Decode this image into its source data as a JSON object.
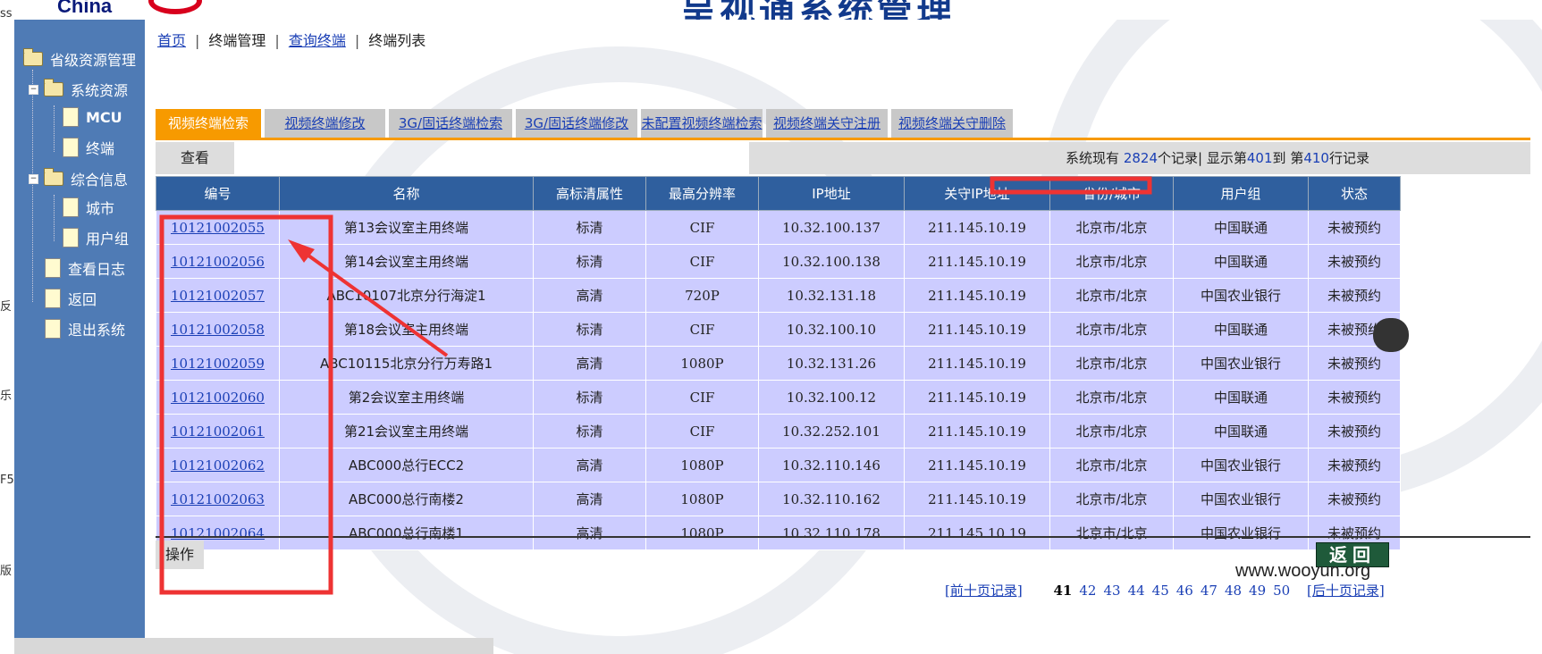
{
  "app": {
    "logo_text": "China",
    "banner_title": "呈视通系统管理"
  },
  "left_strip": [
    "ss",
    "反",
    "乐",
    "F5",
    "版"
  ],
  "sidebar": {
    "root": "省级资源管理",
    "groups": [
      {
        "label": "系统资源",
        "children": [
          "MCU",
          "终端"
        ]
      },
      {
        "label": "综合信息",
        "children": [
          "城市",
          "用户组"
        ]
      }
    ],
    "items": [
      "查看日志",
      "返回",
      "退出系统"
    ]
  },
  "breadcrumb": {
    "home": "首页",
    "terminal_mgmt": "终端管理",
    "query_terminal": "查询终端",
    "terminal_list": "终端列表"
  },
  "tabs": [
    "视频终端检索",
    "视频终端修改",
    "3G/固话终端检索",
    "3G/固话终端修改",
    "未配置视频终端检索",
    "视频终端关守注册",
    "视频终端关守删除"
  ],
  "toolbar": {
    "view_label": "查看",
    "summary_prefix": "系统现有",
    "total": "2824",
    "summary_mid": "个记录",
    "display_prefix": "显示第",
    "from": "401",
    "to_label": "到",
    "to_prefix": "第",
    "to": "410",
    "suffix": "行记录"
  },
  "table": {
    "headers": [
      "编号",
      "名称",
      "高标清属性",
      "最高分辨率",
      "IP地址",
      "关守IP地址",
      "省份/城市",
      "用户组",
      "状态"
    ],
    "rows": [
      [
        "10121002055",
        "第13会议室主用终端",
        "标清",
        "CIF",
        "10.32.100.137",
        "211.145.10.19",
        "北京市/北京",
        "中国联通",
        "未被预约"
      ],
      [
        "10121002056",
        "第14会议室主用终端",
        "标清",
        "CIF",
        "10.32.100.138",
        "211.145.10.19",
        "北京市/北京",
        "中国联通",
        "未被预约"
      ],
      [
        "10121002057",
        "ABC10107北京分行海淀1",
        "高清",
        "720P",
        "10.32.131.18",
        "211.145.10.19",
        "北京市/北京",
        "中国农业银行",
        "未被预约"
      ],
      [
        "10121002058",
        "第18会议室主用终端",
        "标清",
        "CIF",
        "10.32.100.10",
        "211.145.10.19",
        "北京市/北京",
        "中国联通",
        "未被预约"
      ],
      [
        "10121002059",
        "ABC10115北京分行万寿路1",
        "高清",
        "1080P",
        "10.32.131.26",
        "211.145.10.19",
        "北京市/北京",
        "中国农业银行",
        "未被预约"
      ],
      [
        "10121002060",
        "第2会议室主用终端",
        "标清",
        "CIF",
        "10.32.100.12",
        "211.145.10.19",
        "北京市/北京",
        "中国联通",
        "未被预约"
      ],
      [
        "10121002061",
        "第21会议室主用终端",
        "标清",
        "CIF",
        "10.32.252.101",
        "211.145.10.19",
        "北京市/北京",
        "中国联通",
        "未被预约"
      ],
      [
        "10121002062",
        "ABC000总行ECC2",
        "高清",
        "1080P",
        "10.32.110.146",
        "211.145.10.19",
        "北京市/北京",
        "中国农业银行",
        "未被预约"
      ],
      [
        "10121002063",
        "ABC000总行南楼2",
        "高清",
        "1080P",
        "10.32.110.162",
        "211.145.10.19",
        "北京市/北京",
        "中国农业银行",
        "未被预约"
      ],
      [
        "10121002064",
        "ABC000总行南楼1",
        "高清",
        "1080P",
        "10.32.110.178",
        "211.145.10.19",
        "北京市/北京",
        "中国农业银行",
        "未被预约"
      ]
    ]
  },
  "actions": {
    "operate_label": "操作",
    "back_label": "返回"
  },
  "pager": {
    "prev_label": "[前十页记录]",
    "current": "41",
    "pages": [
      "42",
      "43",
      "44",
      "45",
      "46",
      "47",
      "48",
      "49",
      "50"
    ],
    "next_label": "[后十页记录]"
  },
  "watermark": "www.wooyun.org",
  "colors": {
    "sidebar_bg": "#4f7bb5",
    "tab_active": "#f79a00",
    "table_header": "#2f5f9e",
    "row_bg": "#ccccff",
    "annotation": "#ee3333",
    "link": "#1a3fb5"
  }
}
